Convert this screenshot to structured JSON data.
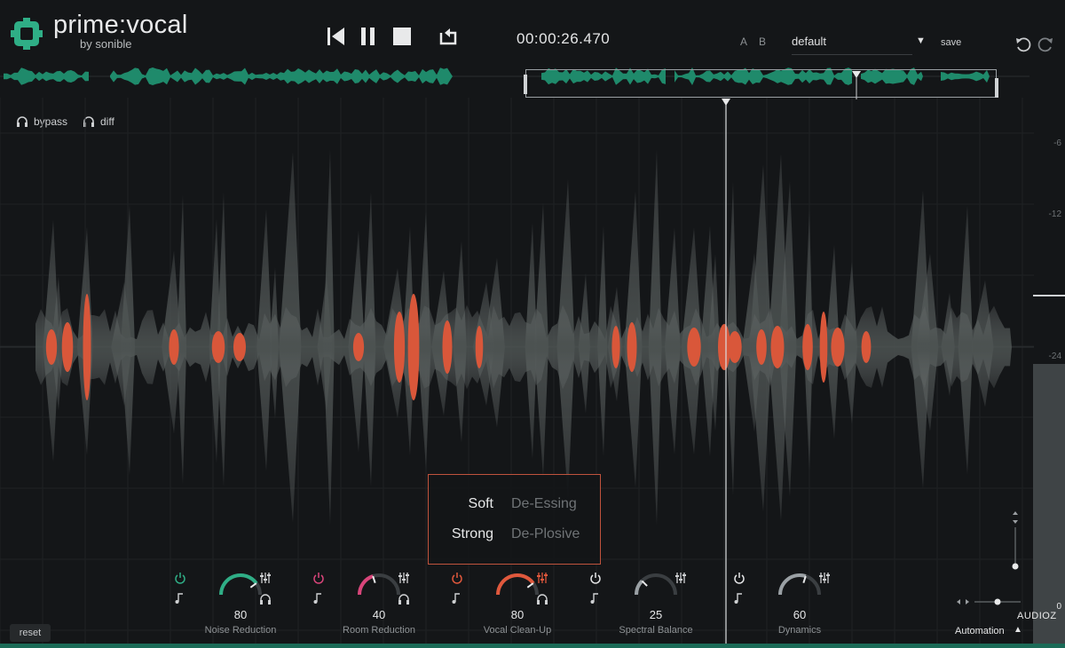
{
  "app": {
    "brand": "prime:vocal",
    "by": "by sonible"
  },
  "transport": {
    "time": "00:00:26.470",
    "a_label": "A",
    "b_label": "B"
  },
  "preset": {
    "name": "default",
    "save_label": "save"
  },
  "monitor": {
    "bypass_label": "bypass",
    "diff_label": "diff"
  },
  "scale": {
    "ticks": [
      "-6",
      "-12",
      "-24",
      "0"
    ]
  },
  "modes": {
    "row1_left": "Soft",
    "row1_right": "De-Essing",
    "row2_left": "Strong",
    "row2_right": "De-Plosive"
  },
  "modules": [
    {
      "name": "Noise Reduction",
      "value": "80",
      "level": 0.8,
      "color": "#2fae86",
      "active": true
    },
    {
      "name": "Room Reduction",
      "value": "40",
      "level": 0.4,
      "color": "#d9457a",
      "active": false
    },
    {
      "name": "Vocal Clean-Up",
      "value": "80",
      "level": 0.8,
      "color": "#e0583c",
      "active": false
    },
    {
      "name": "Spectral Balance",
      "value": "25",
      "level": 0.25,
      "color": "#9aa0a4",
      "active": false
    },
    {
      "name": "Dynamics",
      "value": "60",
      "level": 0.6,
      "color": "#9aa0a4",
      "active": false
    }
  ],
  "footer": {
    "reset_label": "reset",
    "automation_label": "Automation",
    "watermark": "AUDIOZ"
  },
  "colors": {
    "accent_green": "#2fae86",
    "accent_orange": "#e0583c",
    "background": "#141618"
  }
}
